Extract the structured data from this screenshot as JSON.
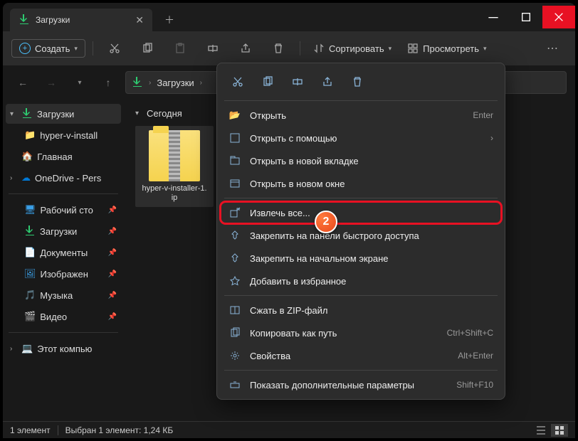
{
  "titlebar": {
    "tab_label": "Загрузки"
  },
  "toolbar": {
    "create": "Создать",
    "sort": "Сортировать",
    "view": "Просмотреть"
  },
  "address": {
    "current": "Загрузки"
  },
  "sidebar": {
    "downloads": "Загрузки",
    "file1": "hyper-v-install",
    "home": "Главная",
    "onedrive": "OneDrive - Pers",
    "desktop": "Рабочий сто",
    "downloads2": "Загрузки",
    "documents": "Документы",
    "pictures": "Изображен",
    "music": "Музыка",
    "video": "Видео",
    "thispc": "Этот компью"
  },
  "content": {
    "group": "Сегодня",
    "filename": "hyper-v-installer-1.\nip"
  },
  "ctx": {
    "open": "Открыть",
    "open_sc": "Enter",
    "open_with": "Открыть с помощью",
    "open_tab": "Открыть в новой вкладке",
    "open_window": "Открыть в новом окне",
    "extract": "Извлечь все...",
    "pin_quick": "Закрепить на панели быстрого доступа",
    "pin_start": "Закрепить на начальном экране",
    "favorite": "Добавить в избранное",
    "compress": "Сжать в ZIP-файл",
    "copy_path": "Копировать как путь",
    "copy_path_sc": "Ctrl+Shift+C",
    "properties": "Свойства",
    "properties_sc": "Alt+Enter",
    "more": "Показать дополнительные параметры",
    "more_sc": "Shift+F10"
  },
  "badge": "2",
  "status": {
    "count": "1 элемент",
    "selected": "Выбран 1 элемент: 1,24 КБ"
  }
}
